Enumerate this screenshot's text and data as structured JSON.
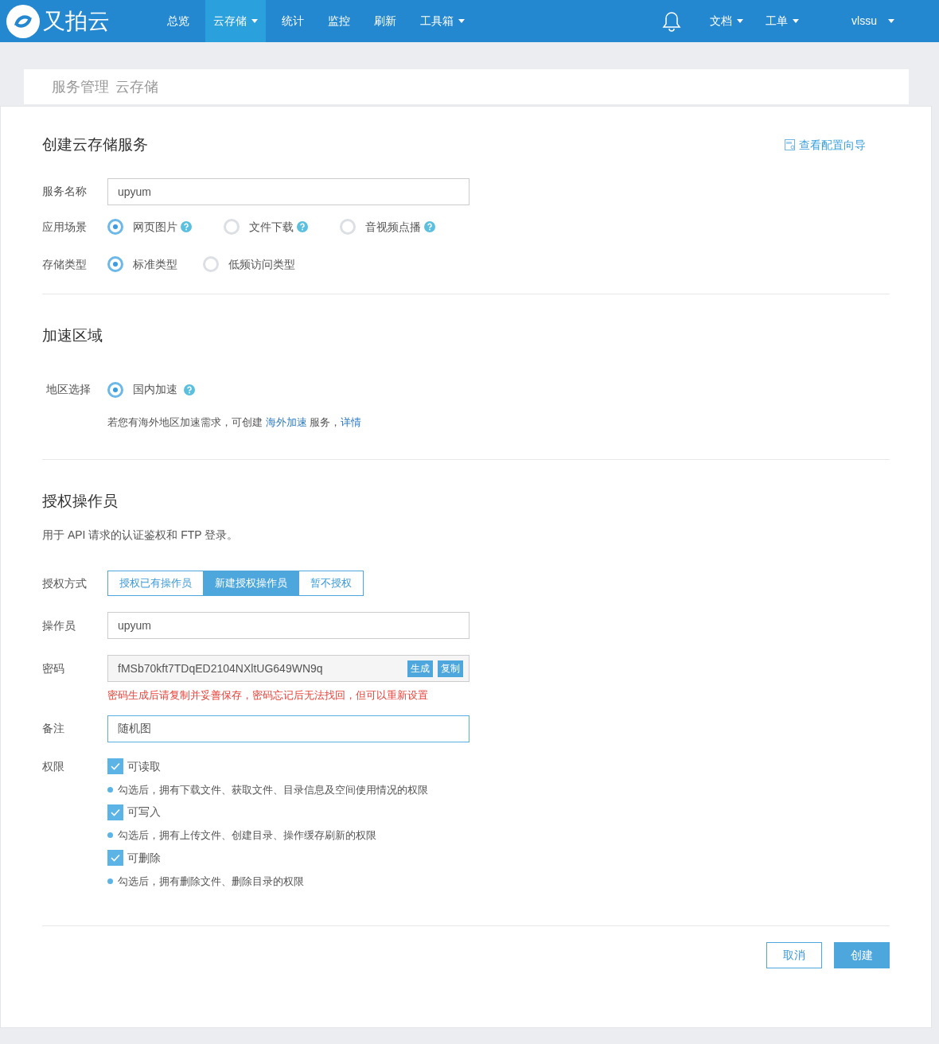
{
  "navbar": {
    "logo_text": "又拍云",
    "items": [
      {
        "label": "总览",
        "selected": false,
        "dropdown": false
      },
      {
        "label": "云存储",
        "selected": true,
        "dropdown": true
      },
      {
        "label": "统计",
        "selected": false,
        "dropdown": false
      },
      {
        "label": "监控",
        "selected": false,
        "dropdown": false
      },
      {
        "label": "刷新",
        "selected": false,
        "dropdown": false
      },
      {
        "label": "工具箱",
        "selected": false,
        "dropdown": true
      }
    ],
    "right_items": [
      {
        "label": "文档",
        "dropdown": true
      },
      {
        "label": "工单",
        "dropdown": true
      }
    ],
    "user": "vlssu"
  },
  "breadcrumb": [
    "服务管理",
    "云存储"
  ],
  "form": {
    "title": "创建云存储服务",
    "guide_link": "查看配置向导",
    "service_name": {
      "label": "服务名称",
      "value": "upyum"
    },
    "scenario": {
      "label": "应用场景",
      "options": [
        {
          "label": "网页图片",
          "selected": true
        },
        {
          "label": "文件下载",
          "selected": false
        },
        {
          "label": "音视频点播",
          "selected": false
        }
      ]
    },
    "storage_type": {
      "label": "存储类型",
      "options": [
        {
          "label": "标准类型",
          "selected": true
        },
        {
          "label": "低频访问类型",
          "selected": false
        }
      ]
    },
    "acceleration": {
      "title": "加速区域",
      "label": "地区选择",
      "options": [
        {
          "label": "国内加速",
          "selected": true
        }
      ],
      "note_parts": [
        "若您有海外地区加速需求，可创建 ",
        "海外加速",
        " 服务，",
        "详情"
      ]
    },
    "operator": {
      "title": "授权操作员",
      "description": "用于 API 请求的认证鉴权和 FTP 登录。",
      "auth_label": "授权方式",
      "auth_options": [
        {
          "label": "授权已有操作员",
          "selected": false
        },
        {
          "label": "新建授权操作员",
          "selected": true
        },
        {
          "label": "暂不授权",
          "selected": false
        }
      ],
      "operator_field": {
        "label": "操作员",
        "value": "upyum"
      },
      "password": {
        "label": "密码",
        "value": "fMSb70kft7TDqED2104NXltUG649WN9q",
        "buttons": [
          "生成",
          "复制"
        ],
        "warning": "密码生成后请复制并妥善保存，密码忘记后无法找回，但可以重新设置"
      },
      "remark": {
        "label": "备注",
        "value": "随机图"
      },
      "permissions_label": "权限",
      "permissions": [
        {
          "label": "可读取",
          "checked": true,
          "hint": "勾选后，拥有下载文件、获取文件、目录信息及空间使用情况的权限"
        },
        {
          "label": "可写入",
          "checked": true,
          "hint": "勾选后，拥有上传文件、创建目录、操作缓存刷新的权限"
        },
        {
          "label": "可删除",
          "checked": true,
          "hint": "勾选后，拥有删除文件、删除目录的权限"
        }
      ]
    },
    "buttons": {
      "cancel": "取消",
      "create": "创建"
    }
  }
}
